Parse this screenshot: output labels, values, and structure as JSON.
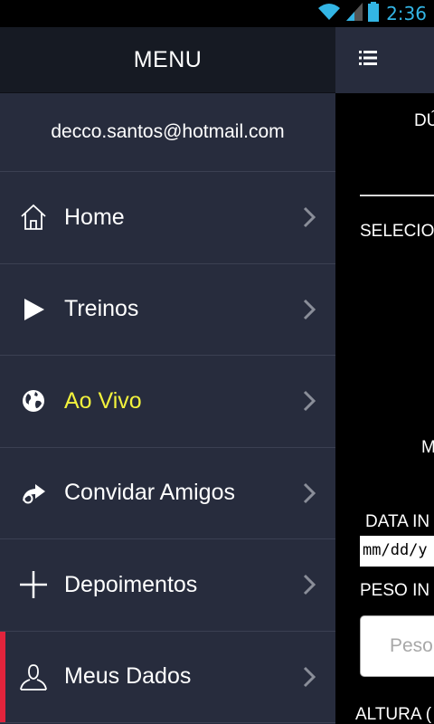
{
  "status": {
    "time": "2:36"
  },
  "drawer": {
    "title": "MENU",
    "email": "decco.santos@hotmail.com",
    "items": [
      {
        "label": "Home",
        "icon": "home-icon"
      },
      {
        "label": "Treinos",
        "icon": "play-icon"
      },
      {
        "label": "Ao Vivo",
        "icon": "globe-icon",
        "highlight_color": "#f2f23c"
      },
      {
        "label": "Convidar Amigos",
        "icon": "share-icon"
      },
      {
        "label": "Depoimentos",
        "icon": "plus-icon"
      },
      {
        "label": "Meus Dados",
        "icon": "user-icon",
        "marker_color": "#e2243c"
      }
    ]
  },
  "content": {
    "heading_partial": "DÚ",
    "select_label_partial": "SELECIO",
    "m_partial": "M",
    "date_label_partial": "DATA IN",
    "date_placeholder_partial": "mm/dd/y",
    "peso_label_partial": "PESO IN",
    "peso_placeholder_partial": "Peso",
    "altura_label_partial": "ALTURA ("
  },
  "colors": {
    "drawer_bg": "#272c3d",
    "header_bg": "#161a23",
    "accent_yellow": "#f2f23c",
    "accent_red": "#e2243c",
    "status_blue": "#33b5e5"
  }
}
